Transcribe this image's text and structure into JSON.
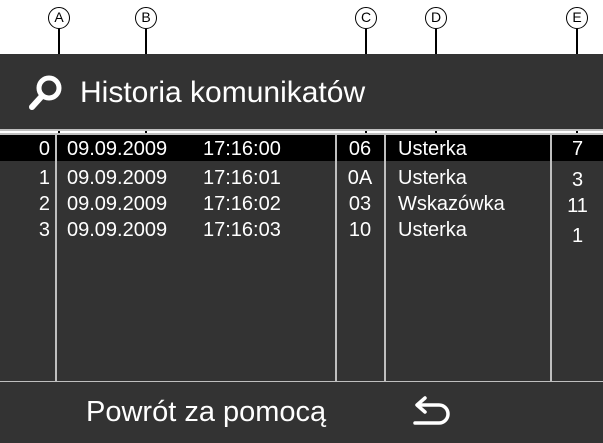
{
  "callouts": [
    "A",
    "B",
    "C",
    "D",
    "E"
  ],
  "title": "Historia komunikatów",
  "rows": [
    {
      "index": "0",
      "date": "09.09.2009",
      "time": "17:16:00",
      "code": "06",
      "type": "Usterka",
      "count": "7"
    },
    {
      "index": "1",
      "date": "09.09.2009",
      "time": "17:16:01",
      "code": "0A",
      "type": "Usterka",
      "count": "3"
    },
    {
      "index": "2",
      "date": "09.09.2009",
      "time": "17:16:02",
      "code": "03",
      "type": "Wskazówka",
      "count": "11"
    },
    {
      "index": "3",
      "date": "09.09.2009",
      "time": "17:16:03",
      "code": "10",
      "type": "Usterka",
      "count": "1"
    }
  ],
  "footer": {
    "label": "Powrót za pomocą",
    "back_icon": "return-arrow-icon"
  },
  "colors": {
    "panel": "#333333",
    "selected_row": "#000000",
    "text": "#ffffff",
    "divider": "#bfbfbf"
  }
}
